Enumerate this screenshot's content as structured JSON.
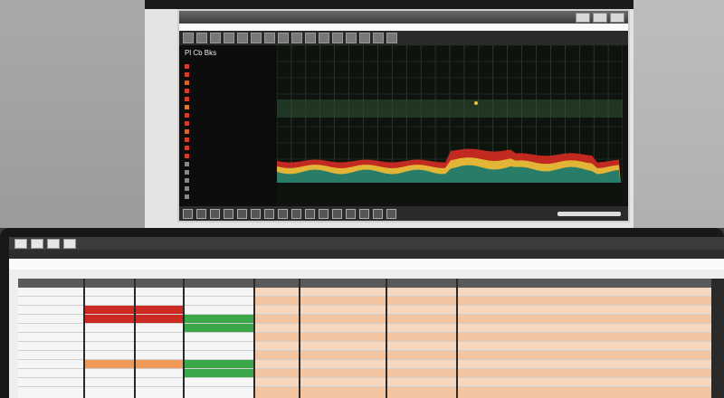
{
  "top_window": {
    "title": "",
    "menus": [
      "",
      "",
      "",
      "",
      ""
    ],
    "toolbar_tools": [
      "",
      "",
      "",
      "",
      "",
      "",
      "",
      "",
      "",
      "",
      "",
      "",
      "",
      "",
      "",
      ""
    ],
    "panel_title": "Pl Cb Bks",
    "channels": [
      {
        "label": "",
        "color": "#d83a2a"
      },
      {
        "label": "",
        "color": "#d83a2a"
      },
      {
        "label": "",
        "color": "#d8632a"
      },
      {
        "label": "",
        "color": "#d83a2a"
      },
      {
        "label": "",
        "color": "#d83a2a"
      },
      {
        "label": "",
        "color": "#e07a2a"
      },
      {
        "label": "",
        "color": "#d83a2a"
      },
      {
        "label": "",
        "color": "#d83a2a"
      },
      {
        "label": "",
        "color": "#d8632a"
      },
      {
        "label": "",
        "color": "#d83a2a"
      },
      {
        "label": "",
        "color": "#d83a2a"
      },
      {
        "label": "",
        "color": "#d83a2a"
      },
      {
        "label": "",
        "color": "#888888"
      },
      {
        "label": "",
        "color": "#888888"
      },
      {
        "label": "",
        "color": "#888888"
      },
      {
        "label": "",
        "color": "#888888"
      },
      {
        "label": "",
        "color": "#888888"
      }
    ],
    "status_buttons": [
      "",
      "",
      "",
      "",
      "",
      "",
      "",
      "",
      "",
      "",
      "",
      "",
      "",
      "",
      "",
      ""
    ],
    "status_text": ""
  },
  "bottom_window": {
    "tabs": [
      "",
      "",
      "",
      ""
    ],
    "menus": [
      "",
      "",
      "",
      "",
      "",
      ""
    ],
    "header_label": "",
    "columns": [
      {
        "head": "",
        "fill": "#f5f5f5",
        "cells": [
          "",
          "",
          "",
          "",
          "",
          "",
          "",
          "",
          "",
          "",
          ""
        ]
      },
      {
        "head": "",
        "fill": "#f5f5f5",
        "cells": [
          "",
          "",
          "",
          "",
          "",
          "",
          "",
          "",
          "",
          "",
          ""
        ]
      },
      {
        "head": "",
        "fill": "#f5f5f5",
        "cells": [
          "",
          "",
          "",
          "",
          "",
          "",
          "",
          "",
          "",
          "",
          ""
        ]
      },
      {
        "head": "",
        "fill": "#f5f5f5",
        "cells": [
          "",
          "",
          "",
          "",
          "",
          "",
          "",
          "",
          "",
          "",
          ""
        ]
      },
      {
        "head": "",
        "fill": "#f3c4a0",
        "cells": [
          "",
          "",
          "",
          "",
          "",
          "",
          "",
          "",
          "",
          "",
          ""
        ]
      },
      {
        "head": "",
        "fill": "#f3c4a0",
        "cells": [
          "",
          "",
          "",
          "",
          "",
          "",
          "",
          "",
          "",
          "",
          ""
        ]
      },
      {
        "head": "",
        "fill": "#f3c4a0",
        "cells": [
          "",
          "",
          "",
          "",
          "",
          "",
          "",
          "",
          "",
          "",
          ""
        ]
      },
      {
        "head": "",
        "fill": "#f3c4a0",
        "cells": [
          "",
          "",
          "",
          "",
          "",
          "",
          "",
          "",
          "",
          "",
          ""
        ]
      }
    ]
  },
  "colors": {
    "red": "#cc2a22",
    "orange": "#f09a5a",
    "green": "#3aa84a",
    "peach": "#f3c4a0",
    "spectrum_teal": "#1f7a6a",
    "spectrum_yellow": "#e6c43a"
  }
}
